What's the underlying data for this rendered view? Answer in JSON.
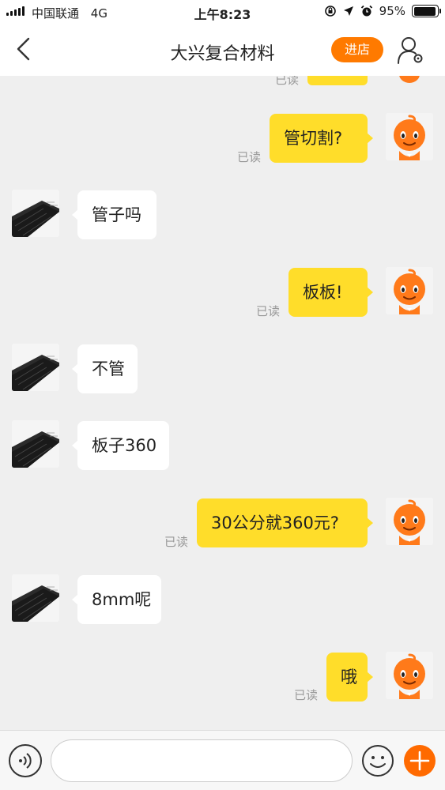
{
  "status_bar": {
    "carrier": "中国联通",
    "network": "4G",
    "time": "上午8:23",
    "battery": "95%",
    "battery_level": 0.95
  },
  "header": {
    "title": "大兴复合材料",
    "shop_button": "进店"
  },
  "read_label": "已读",
  "messages": [
    {
      "side": "me",
      "text": "管切割?",
      "read": "已读"
    },
    {
      "side": "them",
      "text": "管子吗"
    },
    {
      "side": "me",
      "text": "板板!",
      "read": "已读"
    },
    {
      "side": "them",
      "text": "不管"
    },
    {
      "side": "them",
      "text": "板子360"
    },
    {
      "side": "me",
      "text": "30公分就360元?",
      "read": "已读"
    },
    {
      "side": "them",
      "text": "8mm呢"
    },
    {
      "side": "me",
      "text": "哦",
      "read": "已读"
    }
  ],
  "input": {
    "placeholder": "",
    "value": ""
  },
  "icons": {
    "back": "chevron-left-icon",
    "profile": "user-settings-icon",
    "voice": "voice-icon",
    "emoji": "smiley-icon",
    "plus": "plus-icon",
    "me_avatar": "orange-mascot-icon",
    "them_avatar": "carbon-sheet-icon"
  },
  "colors": {
    "accent": "#ff7a00",
    "my_bubble": "#ffdd2a",
    "their_bubble": "#ffffff",
    "background": "#efefef"
  }
}
